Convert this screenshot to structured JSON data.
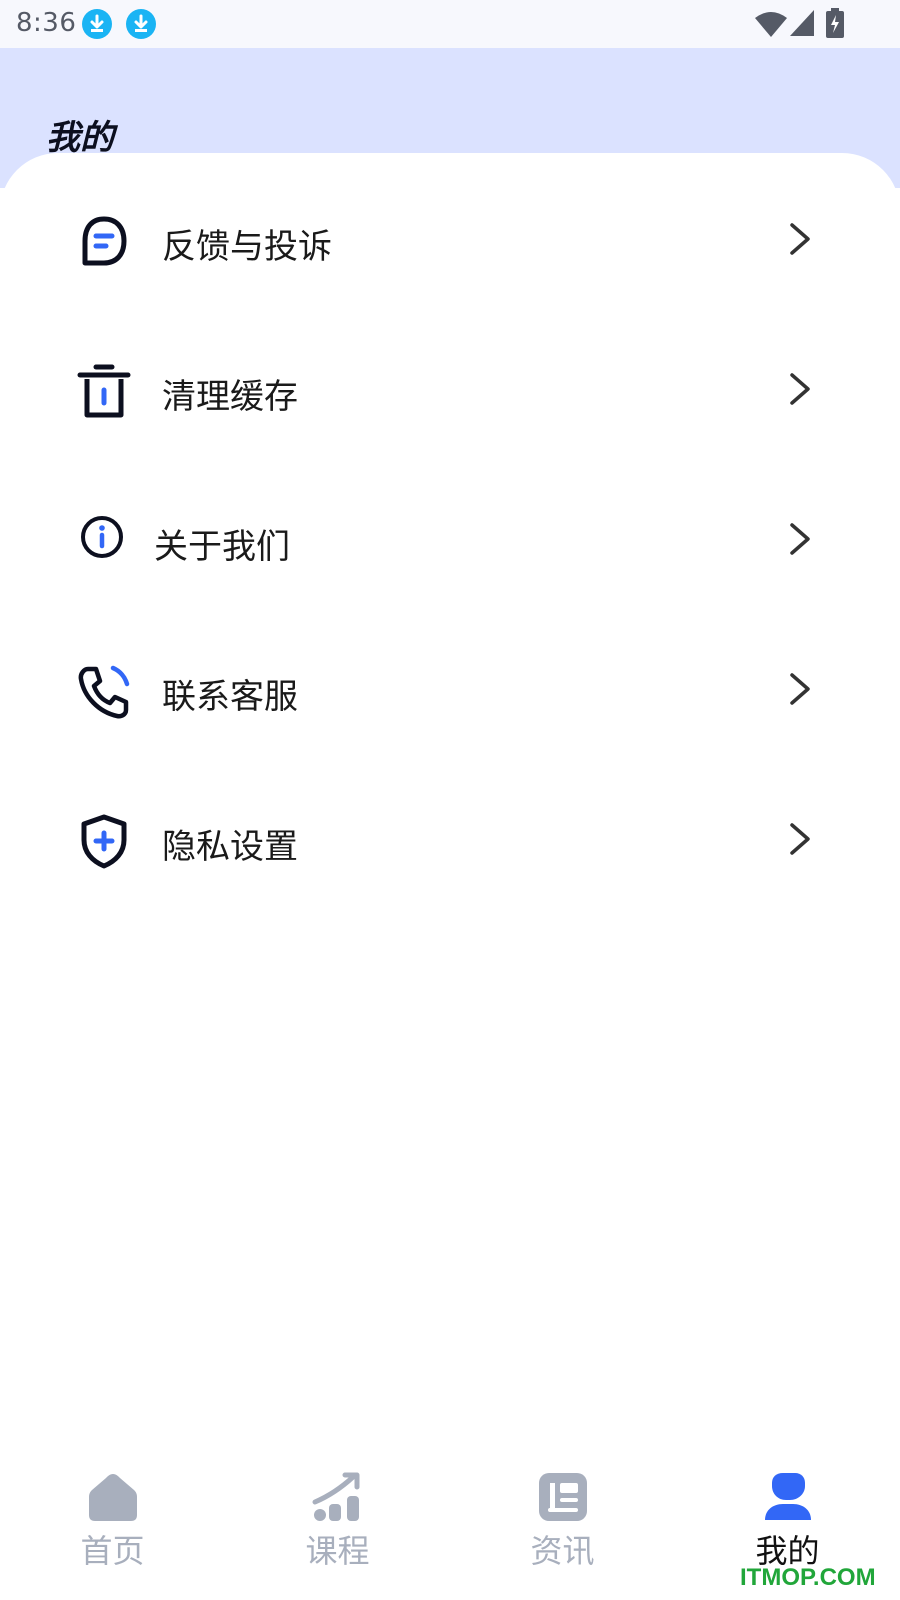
{
  "status_bar": {
    "time": "8:36",
    "icons": [
      "download-icon",
      "download-icon",
      "wifi-icon",
      "signal-icon",
      "battery-charging-icon"
    ]
  },
  "header": {
    "title": "我的"
  },
  "menu": {
    "items": [
      {
        "label": "反馈与投诉",
        "icon": "feedback-icon"
      },
      {
        "label": "清理缓存",
        "icon": "trash-icon"
      },
      {
        "label": "关于我们",
        "icon": "info-icon"
      },
      {
        "label": "联系客服",
        "icon": "phone-icon"
      },
      {
        "label": "隐私设置",
        "icon": "shield-icon"
      }
    ]
  },
  "tabbar": {
    "tabs": [
      {
        "label": "首页",
        "icon": "home-icon",
        "active": false
      },
      {
        "label": "课程",
        "icon": "chart-up-icon",
        "active": false
      },
      {
        "label": "资讯",
        "icon": "news-icon",
        "active": false
      },
      {
        "label": "我的",
        "icon": "user-icon",
        "active": true
      }
    ]
  },
  "watermark": "ITMOP.COM",
  "colors": {
    "accent": "#3267f6",
    "header_bg": "#dbe2ff",
    "inactive_tab": "#a8afbd",
    "status_download": "#1ab4f4",
    "watermark": "#21a63a"
  }
}
